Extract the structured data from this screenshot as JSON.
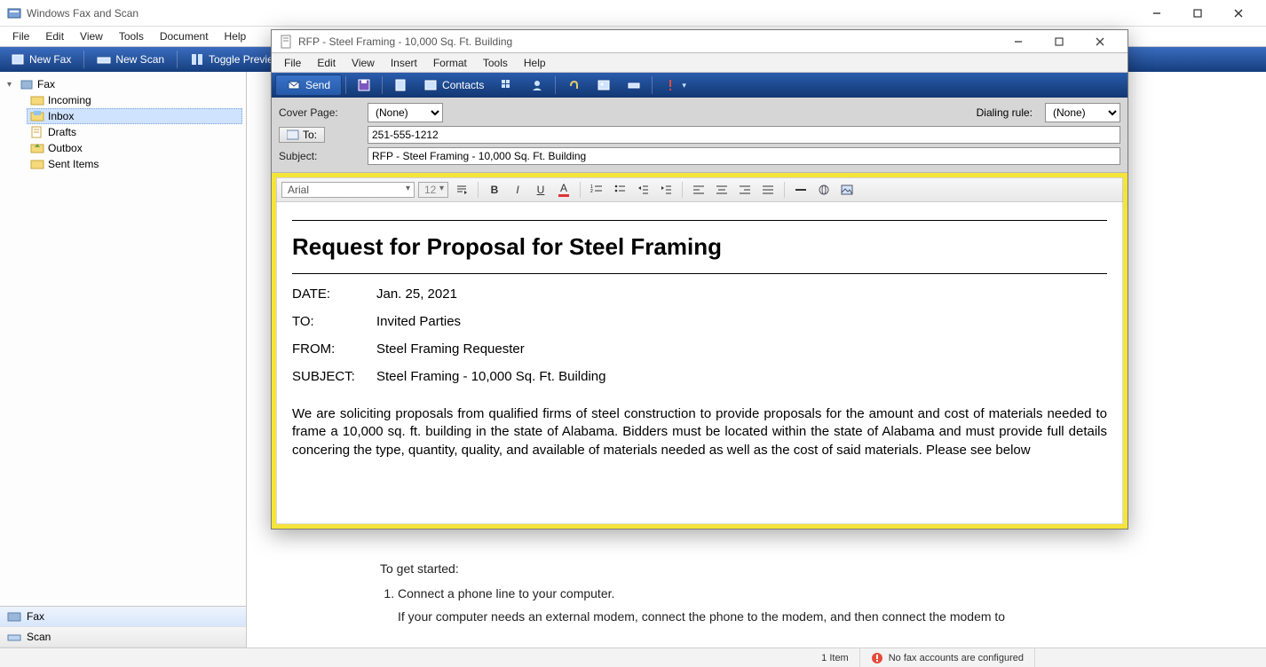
{
  "parent": {
    "title": "Windows Fax and Scan",
    "menus": [
      "File",
      "Edit",
      "View",
      "Tools",
      "Document",
      "Help"
    ],
    "toolbar": {
      "new_fax": "New Fax",
      "new_scan": "New Scan",
      "toggle_preview": "Toggle Preview"
    },
    "tree": {
      "root": "Fax",
      "items": [
        {
          "label": "Incoming"
        },
        {
          "label": "Inbox",
          "selected": true
        },
        {
          "label": "Drafts"
        },
        {
          "label": "Outbox"
        },
        {
          "label": "Sent Items"
        }
      ]
    },
    "tabs": {
      "fax": "Fax",
      "scan": "Scan"
    },
    "preview": {
      "intro": "To get started:",
      "step1": "Connect a phone line to your computer.",
      "step1_sub": "If your computer needs an external modem, connect the phone to the modem, and then connect the modem to"
    },
    "status": {
      "items": "1 Item",
      "warn": "No fax accounts are configured"
    }
  },
  "compose": {
    "title": "RFP - Steel Framing - 10,000 Sq. Ft. Building",
    "menus": [
      "File",
      "Edit",
      "View",
      "Insert",
      "Format",
      "Tools",
      "Help"
    ],
    "toolbar": {
      "send": "Send",
      "contacts": "Contacts"
    },
    "fields": {
      "cover_label": "Cover Page:",
      "cover_value": "(None)",
      "dialing_label": "Dialing rule:",
      "dialing_value": "(None)",
      "to_label": "To:",
      "to_value": "251-555-1212",
      "subject_label": "Subject:",
      "subject_value": "RFP - Steel Framing - 10,000 Sq. Ft. Building"
    },
    "format": {
      "font": "Arial",
      "size": "12"
    },
    "doc": {
      "title": "Request for Proposal for Steel Framing",
      "date_k": "DATE:",
      "date_v": "Jan. 25, 2021",
      "to_k": "TO:",
      "to_v": "Invited Parties",
      "from_k": "FROM:",
      "from_v": "Steel Framing Requester",
      "subj_k": "SUBJECT:",
      "subj_v": "Steel Framing - 10,000 Sq. Ft. Building",
      "body": "We are soliciting proposals from qualified firms of steel construction to provide proposals for the amount and cost of materials needed to frame a 10,000 sq. ft. building in the state of Alabama. Bidders must be located within the state of Alabama and must provide full details concering the type, quantity, quality, and available of materials needed as well as the cost of said materials. Please see below"
    }
  }
}
